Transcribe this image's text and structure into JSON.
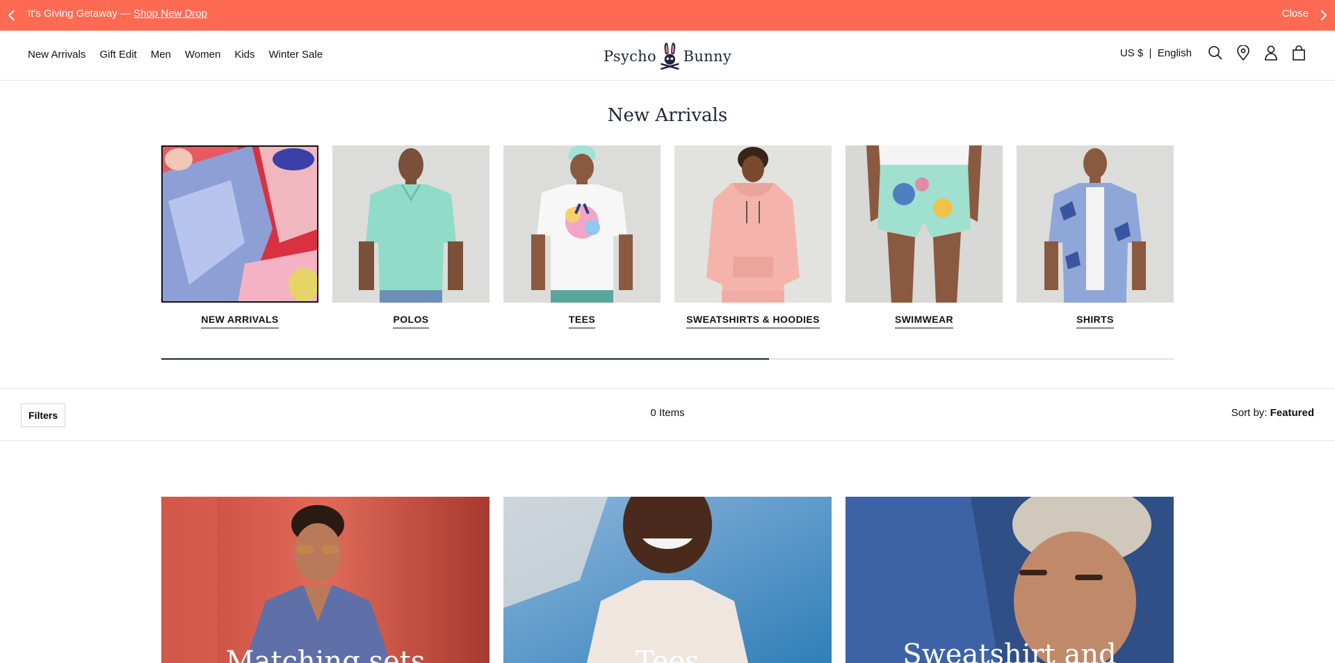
{
  "announcement": {
    "text": "It's Giving Getaway — ",
    "link": "Shop New Drop",
    "close": "Close"
  },
  "header": {
    "nav": [
      "New Arrivals",
      "Gift Edit",
      "Men",
      "Women",
      "Kids",
      "Winter Sale"
    ],
    "logo_left": "Psycho",
    "logo_right": "Bunny",
    "locale": "US $  |  English",
    "icons": [
      "search-icon",
      "location-icon",
      "account-icon",
      "bag-icon"
    ]
  },
  "main": {
    "title": "New Arrivals",
    "categories": [
      {
        "label": "NEW ARRIVALS",
        "active": true
      },
      {
        "label": "POLOS",
        "active": false
      },
      {
        "label": "TEES",
        "active": false
      },
      {
        "label": "SWEATSHIRTS & HOODIES",
        "active": false
      },
      {
        "label": "SWIMWEAR",
        "active": false
      },
      {
        "label": "SHIRTS",
        "active": false
      }
    ],
    "carousel_progress": 0.6
  },
  "filterbar": {
    "filters_label": "Filters",
    "items_count": "0 Items",
    "sort_prefix": "Sort by: ",
    "sort_value": "Featured"
  },
  "tiles": [
    {
      "title": "Matching sets"
    },
    {
      "title": "Tees"
    },
    {
      "title": "Sweatshirt and"
    }
  ],
  "colors": {
    "announcement_bg": "#ff6b52",
    "brand_navy": "#1b2436"
  }
}
